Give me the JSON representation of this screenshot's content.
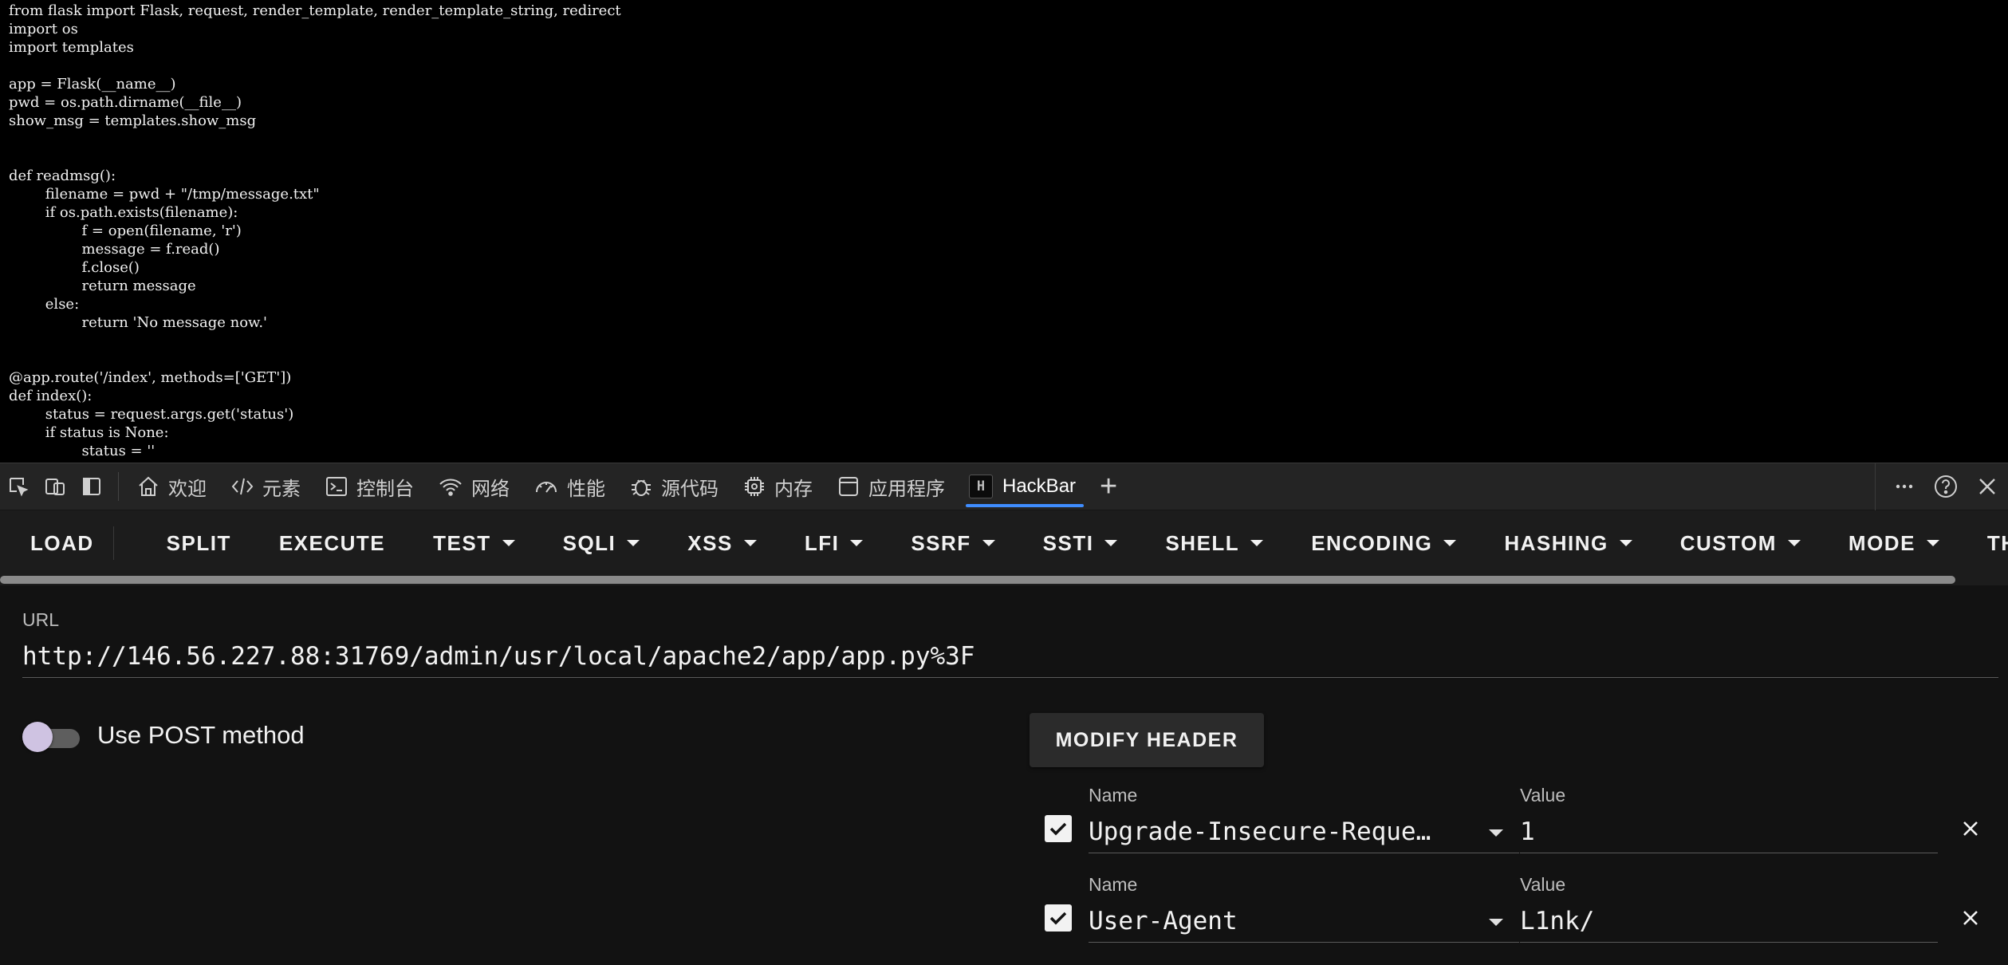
{
  "source": {
    "code": "from flask import Flask, request, render_template, render_template_string, redirect\nimport os\nimport templates\n\napp = Flask(__name__)\npwd = os.path.dirname(__file__)\nshow_msg = templates.show_msg\n\n\ndef readmsg():\n\tfilename = pwd + \"/tmp/message.txt\"\n\tif os.path.exists(filename):\n\t\tf = open(filename, 'r')\n\t\tmessage = f.read()\n\t\tf.close()\n\t\treturn message\n\telse:\n\t\treturn 'No message now.'\n\n\n@app.route('/index', methods=['GET'])\ndef index():\n\tstatus = request.args.get('status')\n\tif status is None:\n\t\tstatus = ''"
  },
  "devtools": {
    "tabs": [
      {
        "label": "欢迎",
        "icon": "home-icon"
      },
      {
        "label": "元素",
        "icon": "code-icon"
      },
      {
        "label": "控制台",
        "icon": "console-icon"
      },
      {
        "label": "网络",
        "icon": "wifi-icon"
      },
      {
        "label": "性能",
        "icon": "gauge-icon"
      },
      {
        "label": "源代码",
        "icon": "bug-icon"
      },
      {
        "label": "内存",
        "icon": "chip-icon"
      },
      {
        "label": "应用程序",
        "icon": "app-icon"
      },
      {
        "label": "HackBar",
        "icon": "hackbar-logo-icon",
        "logo_text": "H",
        "active": true
      }
    ],
    "add_tab": "+"
  },
  "hackbar": {
    "menu": {
      "load": "LOAD",
      "split": "SPLIT",
      "execute": "EXECUTE",
      "test": "TEST",
      "sqli": "SQLI",
      "xss": "XSS",
      "lfi": "LFI",
      "ssrf": "SSRF",
      "ssti": "SSTI",
      "shell": "SHELL",
      "encoding": "ENCODING",
      "hashing": "HASHING",
      "custom": "CUSTOM",
      "mode": "MODE",
      "theme": "THEME"
    },
    "url_label": "URL",
    "url": "http://146.56.227.88:31769/admin/usr/local/apache2/app/app.py%3F",
    "use_post_label": "Use POST method",
    "use_post": false,
    "modify_header_label": "MODIFY HEADER",
    "headers": [
      {
        "enabled": true,
        "name_label": "Name",
        "name": "Upgrade-Insecure-Requests",
        "value_label": "Value",
        "value": "1"
      },
      {
        "enabled": true,
        "name_label": "Name",
        "name": "User-Agent",
        "value_label": "Value",
        "value": "L1nk/"
      }
    ]
  },
  "colors": {
    "tab_underline": "#3f8dff",
    "background": "#121212",
    "toggle_knob": "#cfc3e2"
  }
}
